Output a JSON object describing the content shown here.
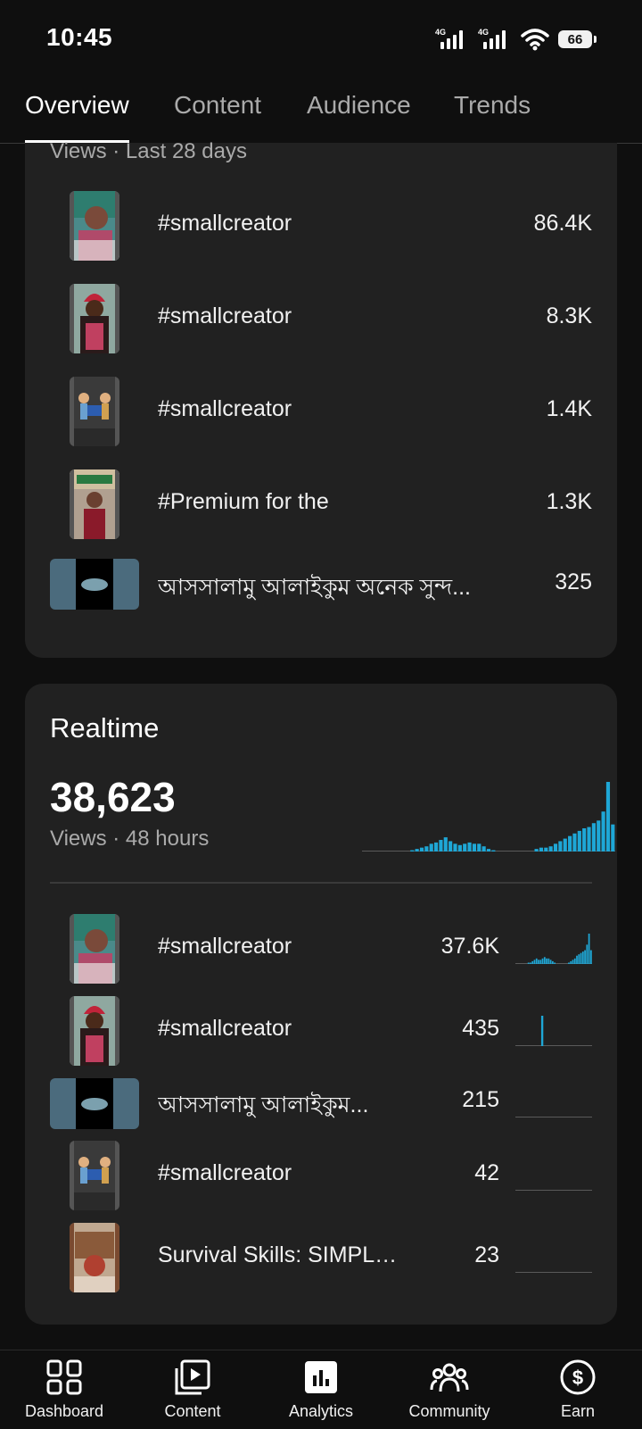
{
  "status_bar": {
    "time": "10:45",
    "network1": "4G",
    "network2": "4G",
    "battery": "66"
  },
  "tabs": [
    {
      "label": "Overview",
      "active": true
    },
    {
      "label": "Content",
      "active": false
    },
    {
      "label": "Audience",
      "active": false
    },
    {
      "label": "Trends",
      "active": false
    }
  ],
  "top_content": {
    "subtitle": "Views · Last 28 days",
    "items": [
      {
        "title": "#smallcreator",
        "value": "86.4K",
        "thumb": "portrait-girl"
      },
      {
        "title": "#smallcreator",
        "value": "8.3K",
        "thumb": "portrait-redhat"
      },
      {
        "title": "#smallcreator",
        "value": "1.4K",
        "thumb": "portrait-cartoon"
      },
      {
        "title": "#Premium for the",
        "value": "1.3K",
        "thumb": "portrait-man"
      },
      {
        "title": "আসসালামু আলাইকুম  অনেক সুন্দ...",
        "value": "325",
        "thumb": "landscape-mosque"
      }
    ]
  },
  "realtime": {
    "title": "Realtime",
    "total": "38,623",
    "subtitle": "Views · 48 hours",
    "chart_values": [
      0,
      0,
      0,
      0,
      0,
      0,
      0,
      0,
      0,
      0,
      1,
      2,
      3,
      4,
      6,
      7,
      9,
      11,
      8,
      6,
      5,
      6,
      7,
      6,
      6,
      4,
      2,
      1,
      0,
      0,
      0,
      0,
      0,
      0,
      0,
      0,
      2,
      3,
      3,
      4,
      6,
      8,
      10,
      12,
      14,
      16,
      18,
      19,
      22,
      24,
      31,
      54,
      21
    ],
    "items": [
      {
        "title": "#smallcreator",
        "value": "37.6K",
        "thumb": "portrait-girl",
        "spark": [
          0,
          0,
          0,
          0,
          0,
          0,
          1,
          1,
          2,
          3,
          4,
          3,
          3,
          4,
          5,
          4,
          4,
          3,
          2,
          1,
          0,
          0,
          0,
          0,
          0,
          0,
          1,
          2,
          3,
          4,
          6,
          7,
          8,
          9,
          10,
          14,
          22,
          10
        ]
      },
      {
        "title": "#smallcreator",
        "value": "435",
        "thumb": "portrait-redhat",
        "spark": [
          0,
          0,
          0,
          0,
          0,
          0,
          0,
          0,
          0,
          0,
          1,
          0,
          0,
          0,
          0,
          0,
          0,
          0,
          0,
          0,
          0,
          0,
          0,
          0,
          0,
          0,
          0,
          0,
          0,
          0
        ]
      },
      {
        "title": "আসসালামু আলাইকুম...",
        "value": "215",
        "thumb": "landscape-mosque",
        "spark": [
          0,
          0,
          0,
          0,
          0,
          0,
          0,
          0,
          0,
          0,
          0,
          0,
          0,
          0,
          0,
          0,
          0,
          0,
          0,
          0
        ]
      },
      {
        "title": "#smallcreator",
        "value": "42",
        "thumb": "portrait-cartoon",
        "spark": [
          0,
          0,
          0,
          0,
          0,
          0,
          0,
          0,
          0,
          0,
          0,
          0,
          0,
          0,
          0,
          0,
          0,
          0,
          0,
          0
        ]
      },
      {
        "title": "Survival Skills: SIMPLE...",
        "value": "23",
        "thumb": "portrait-food",
        "spark": [
          0,
          0,
          0,
          0,
          0,
          0,
          0,
          0,
          0,
          0,
          0,
          0,
          0,
          0,
          0,
          0,
          0,
          0,
          0,
          0
        ]
      }
    ]
  },
  "bottom_nav": [
    {
      "label": "Dashboard",
      "icon": "dashboard-icon"
    },
    {
      "label": "Content",
      "icon": "content-icon"
    },
    {
      "label": "Analytics",
      "icon": "analytics-icon",
      "active": true
    },
    {
      "label": "Community",
      "icon": "community-icon"
    },
    {
      "label": "Earn",
      "icon": "earn-icon"
    }
  ],
  "colors": {
    "background": "#0f0f0f",
    "card": "#212121",
    "chart_bar": "#1ea7d6",
    "muted_text": "#aaaaaa"
  }
}
